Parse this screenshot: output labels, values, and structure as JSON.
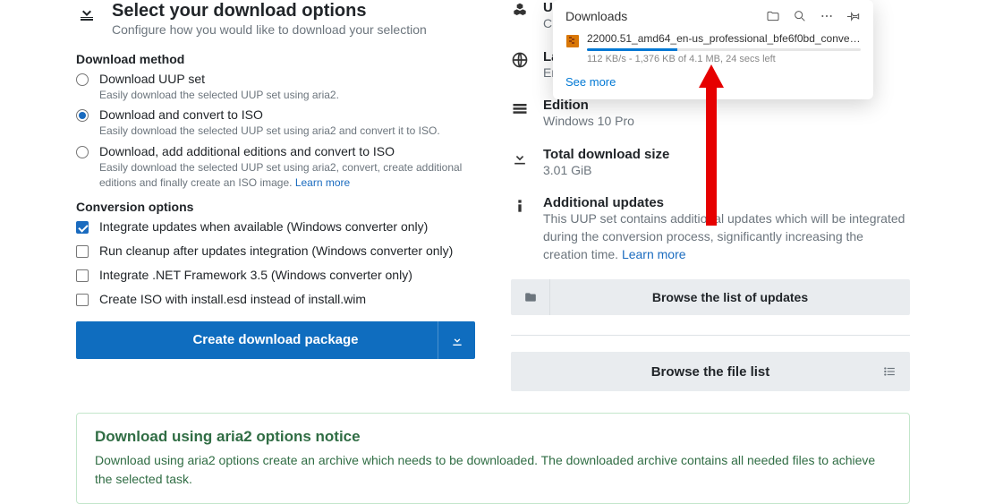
{
  "section": {
    "title": "Select your download options",
    "subtitle": "Configure how you would like to download your selection"
  },
  "download_method": {
    "heading": "Download method",
    "options": [
      {
        "title": "Download UUP set",
        "desc": "Easily download the selected UUP set using aria2.",
        "checked": false
      },
      {
        "title": "Download and convert to ISO",
        "desc": "Easily download the selected UUP set using aria2 and convert it to ISO.",
        "checked": true
      },
      {
        "title": "Download, add additional editions and convert to ISO",
        "desc": "Easily download the selected UUP set using aria2, convert, create additional editions and finally create an ISO image.",
        "learn_more": "Learn more",
        "checked": false
      }
    ]
  },
  "conversion": {
    "heading": "Conversion options",
    "options": [
      {
        "label": "Integrate updates when available (Windows converter only)",
        "checked": true
      },
      {
        "label": "Run cleanup after updates integration (Windows converter only)",
        "checked": false
      },
      {
        "label": "Integrate .NET Framework 3.5 (Windows converter only)",
        "checked": false
      },
      {
        "label": "Create ISO with install.esd instead of install.wim",
        "checked": false
      }
    ]
  },
  "create_button": "Create download package",
  "summary": {
    "u": {
      "label": "U",
      "value": "C"
    },
    "la": {
      "label": "La",
      "value": "En"
    },
    "edition": {
      "label": "Edition",
      "value": "Windows 10 Pro"
    },
    "size": {
      "label": "Total download size",
      "value": "3.01 GiB"
    },
    "additional": {
      "label": "Additional updates",
      "value": "This UUP set contains additional updates which will be integrated during the conversion process, significantly increasing the creation time.",
      "link": "Learn more"
    }
  },
  "browse_updates": "Browse the list of updates",
  "browse_files": "Browse the file list",
  "notice": {
    "title": "Download using aria2 options notice",
    "body": "Download using aria2 options create an archive which needs to be downloaded. The downloaded archive contains all needed files to achieve the selected task."
  },
  "downloads_popup": {
    "title": "Downloads",
    "filename": "22000.51_amd64_en-us_professional_bfe6f0bd_convert....",
    "status": "112 KB/s - 1,376 KB of 4.1 MB, 24 secs left",
    "progress_pct": 33,
    "see_more": "See more"
  }
}
